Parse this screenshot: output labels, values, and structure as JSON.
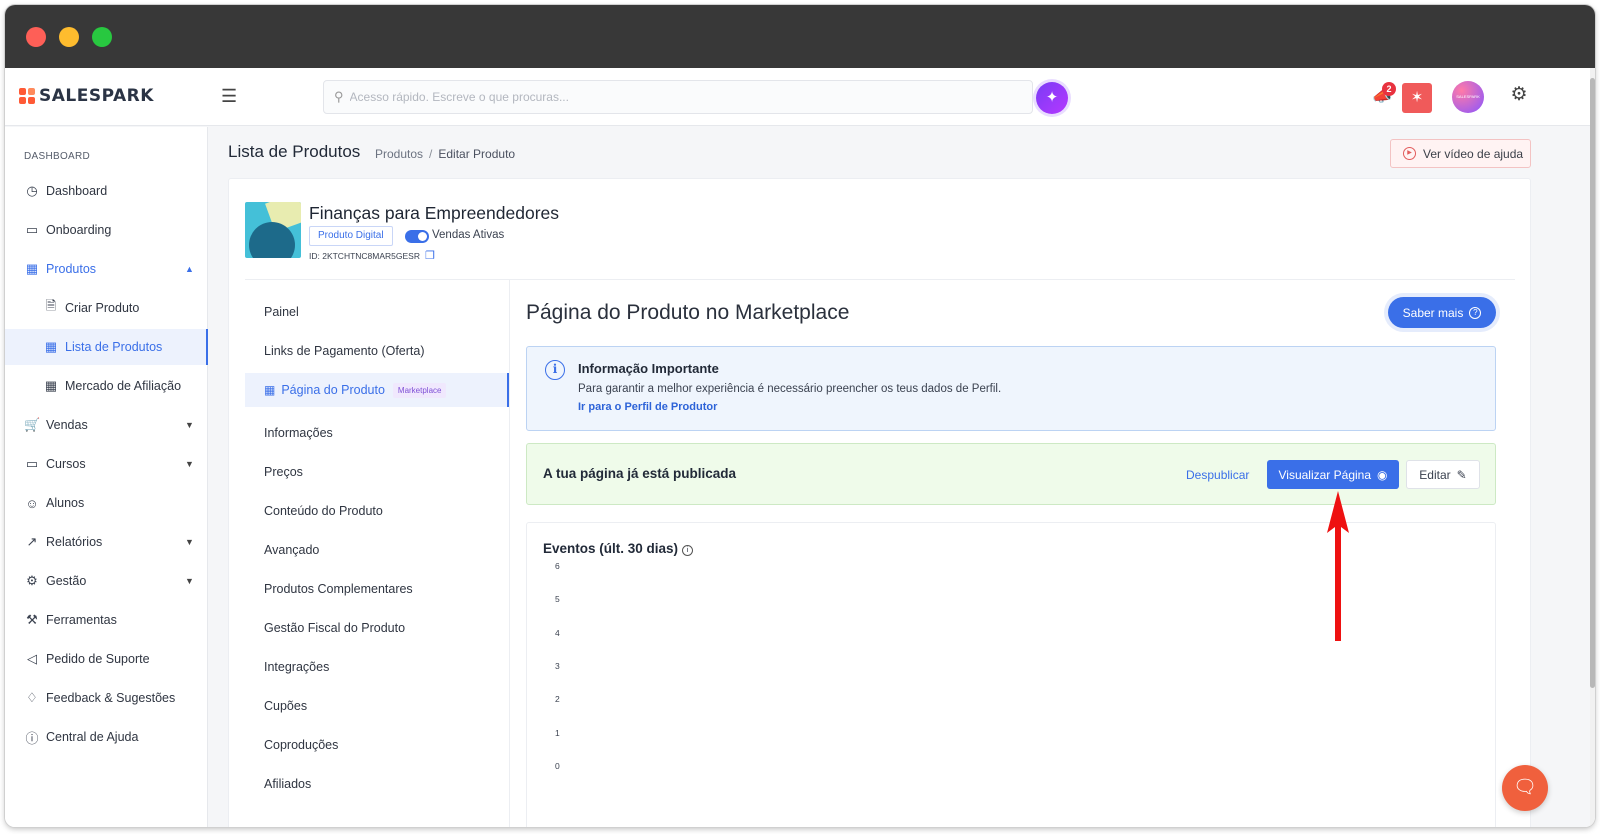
{
  "brand": {
    "name": "SALESPARK",
    "accent": "#3a6fe8"
  },
  "topbar": {
    "search_placeholder": "Acesso rápido. Escreve o que procuras...",
    "notification_count": "2",
    "avatar_text": "SALESPARK"
  },
  "sidebar": {
    "section": "DASHBOARD",
    "items": [
      {
        "label": "Dashboard",
        "icon": "gauge-icon"
      },
      {
        "label": "Onboarding",
        "icon": "video-icon"
      },
      {
        "label": "Produtos",
        "icon": "grid-icon"
      },
      {
        "label": "Criar Produto",
        "icon": "file-plus-icon"
      },
      {
        "label": "Lista de Produtos",
        "icon": "table-icon"
      },
      {
        "label": "Mercado de Afiliação",
        "icon": "store-icon"
      },
      {
        "label": "Vendas",
        "icon": "cart-icon"
      },
      {
        "label": "Cursos",
        "icon": "monitor-icon"
      },
      {
        "label": "Alunos",
        "icon": "users-icon"
      },
      {
        "label": "Relatórios",
        "icon": "chart-line-icon"
      },
      {
        "label": "Gestão",
        "icon": "gear-icon"
      },
      {
        "label": "Ferramentas",
        "icon": "wrench-icon"
      },
      {
        "label": "Pedido de Suporte",
        "icon": "megaphone-icon"
      },
      {
        "label": "Feedback & Sugestões",
        "icon": "bell-icon"
      },
      {
        "label": "Central de Ajuda",
        "icon": "help-circle-icon"
      }
    ]
  },
  "header": {
    "title": "Lista de Produtos",
    "breadcrumb": [
      "Produtos",
      "Editar Produto"
    ],
    "help_video": "Ver vídeo de ajuda"
  },
  "product": {
    "name": "Finanças para Empreendedores",
    "type": "Produto Digital",
    "sales_status": "Vendas Ativas",
    "id": "ID: 2KTCHTNC8MAR5GESR"
  },
  "tabs": [
    {
      "label": "Painel"
    },
    {
      "label": "Links de Pagamento (Oferta)"
    },
    {
      "label": "Página do Produto",
      "badge": "Marketplace"
    },
    {
      "label": "Informações"
    },
    {
      "label": "Preços"
    },
    {
      "label": "Conteúdo do Produto"
    },
    {
      "label": "Avançado"
    },
    {
      "label": "Produtos Complementares"
    },
    {
      "label": "Gestão Fiscal do Produto"
    },
    {
      "label": "Integrações"
    },
    {
      "label": "Cupões"
    },
    {
      "label": "Coproduções"
    },
    {
      "label": "Afiliados"
    }
  ],
  "panel": {
    "title": "Página do Produto no Marketplace",
    "learn_more": "Saber mais",
    "info": {
      "title": "Informação Importante",
      "text": "Para garantir a melhor experiência é necessário preencher os teus dados de Perfil.",
      "link": "Ir para o Perfil de Produtor"
    },
    "publish": {
      "text": "A tua página já está publicada",
      "unpublish": "Despublicar",
      "view": "Visualizar Página",
      "edit": "Editar"
    }
  },
  "chart_data": {
    "type": "line",
    "title": "Eventos (últ. 30 dias)",
    "y_ticks": [
      "6",
      "5",
      "4",
      "3",
      "2",
      "1",
      "0"
    ],
    "ylim": [
      0,
      6
    ],
    "series": []
  }
}
